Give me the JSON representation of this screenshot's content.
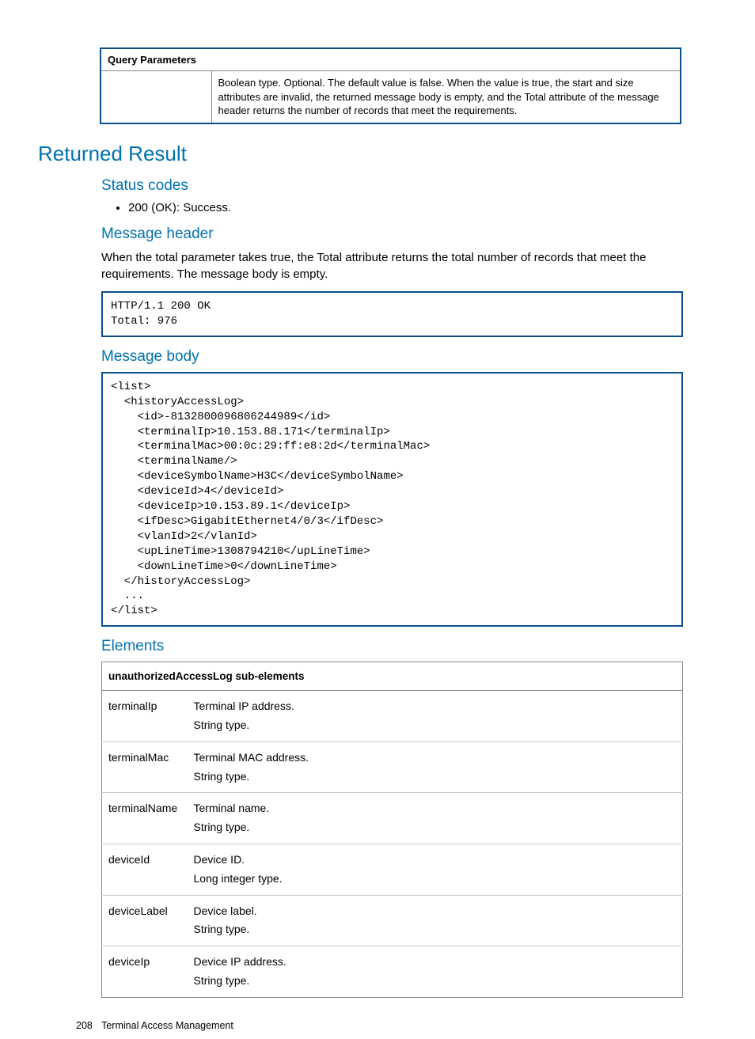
{
  "query_params": {
    "header": "Query Parameters",
    "desc": "Boolean type. Optional. The default value is false. When the value is true, the start and size attributes are invalid, the returned message body is empty, and the Total attribute of the message header returns the number of records that meet the requirements."
  },
  "returned_result": {
    "title": "Returned Result",
    "status_codes": {
      "heading": "Status codes",
      "item1": "200 (OK): Success."
    },
    "message_header": {
      "heading": "Message header",
      "paragraph": "When the total parameter takes true, the Total attribute returns the total number of records that meet the requirements. The message body is empty.",
      "code": "HTTP/1.1 200 OK\nTotal: 976"
    },
    "message_body": {
      "heading": "Message body",
      "code": "<list>\n  <historyAccessLog>\n    <id>-8132800096806244989</id>\n    <terminalIp>10.153.88.171</terminalIp>\n    <terminalMac>00:0c:29:ff:e8:2d</terminalMac>\n    <terminalName/>\n    <deviceSymbolName>H3C</deviceSymbolName>\n    <deviceId>4</deviceId>\n    <deviceIp>10.153.89.1</deviceIp>\n    <ifDesc>GigabitEthernet4/0/3</ifDesc>\n    <vlanId>2</vlanId>\n    <upLineTime>1308794210</upLineTime>\n    <downLineTime>0</downLineTime>\n  </historyAccessLog>\n  ...\n</list>"
    },
    "elements": {
      "heading": "Elements",
      "table_header": "unauthorizedAccessLog sub-elements",
      "rows": [
        {
          "k": "terminalIp",
          "v": "Terminal IP address.\nString type."
        },
        {
          "k": "terminalMac",
          "v": "Terminal MAC address.\nString type."
        },
        {
          "k": "terminalName",
          "v": "Terminal name.\nString type."
        },
        {
          "k": "deviceId",
          "v": "Device ID.\nLong integer type."
        },
        {
          "k": "deviceLabel",
          "v": "Device label.\nString type."
        },
        {
          "k": "deviceIp",
          "v": "Device IP address.\nString type."
        }
      ]
    }
  },
  "footer": {
    "page_number": "208",
    "section": "Terminal Access Management"
  }
}
